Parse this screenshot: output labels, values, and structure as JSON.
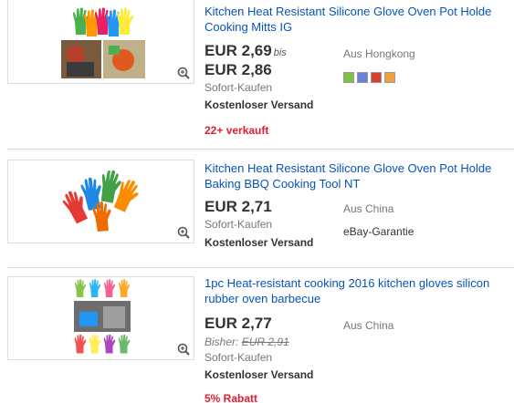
{
  "listings": [
    {
      "title_line1": "Kitchen Heat Resistant Silicone Glove Oven Pot Holde",
      "title_line2": "Cooking Mitts IG",
      "price_low": "EUR 2,69",
      "price_sep": "bis",
      "price_high": "EUR 2,86",
      "buy_format": "Sofort-Kaufen",
      "shipping": "Kostenloser Versand",
      "sold": "22+ verkauft",
      "location": "Aus Hongkong",
      "color_swatches": [
        "#7dc242",
        "#6a7fd9",
        "#d9402b",
        "#f0a040"
      ]
    },
    {
      "title_line1": "Kitchen Heat Resistant Silicone Glove Oven Pot Holde",
      "title_line2": "Baking BBQ Cooking Tool NT",
      "price": "EUR 2,71",
      "buy_format": "Sofort-Kaufen",
      "shipping": "Kostenloser Versand",
      "location": "Aus China",
      "guarantee": "eBay-Garantie"
    },
    {
      "title_line1": "1pc Heat-resistant cooking 2016 kitchen gloves silicon",
      "title_line2": "rubber oven barbecue",
      "price": "EUR 2,77",
      "previous_label": "Bisher:",
      "previous_price": "EUR 2,91",
      "buy_format": "Sofort-Kaufen",
      "shipping": "Kostenloser Versand",
      "discount": "5% Rabatt",
      "location": "Aus China"
    }
  ]
}
